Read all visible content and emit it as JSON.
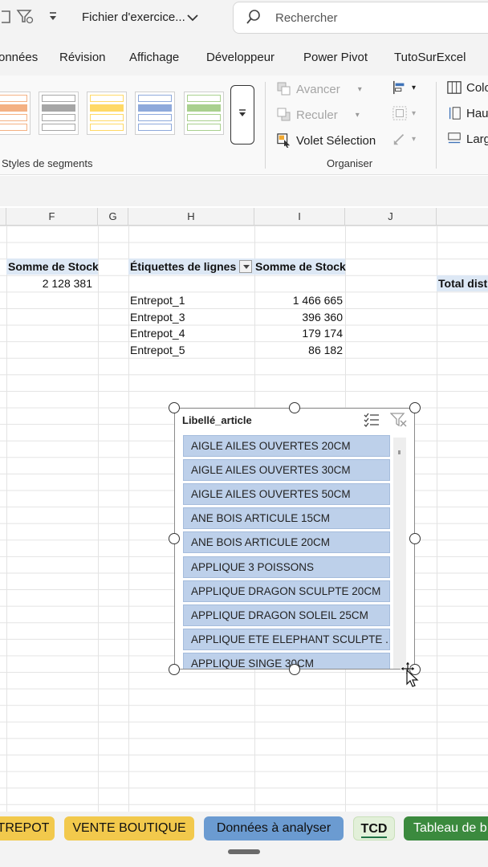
{
  "titlebar": {
    "file_name": "Fichier d'exercice...",
    "search_placeholder": "Rechercher"
  },
  "menu": [
    "onnées",
    "Révision",
    "Affichage",
    "Développeur",
    "Power Pivot",
    "TutoSurExcel"
  ],
  "ribbon": {
    "slicer_styles_label": "Styles de segments",
    "arrange_label": "Organiser",
    "bring_forward": "Avancer",
    "send_backward": "Reculer",
    "selection_pane": "Volet Sélection",
    "columns": "Colo",
    "height": "Hau",
    "width": "Larg",
    "style_colors": [
      "#f4b183",
      "#a6a6a6",
      "#ffd966",
      "#8ea9db",
      "#a9d08e"
    ]
  },
  "columns": [
    "F",
    "G",
    "H",
    "I",
    "J"
  ],
  "left_value_header": "Somme de Stock",
  "left_total": "2 128 381",
  "pivot": {
    "row_label_header": "Étiquettes de lignes",
    "value_header": "Somme de Stock",
    "rows": [
      {
        "label": "Entrepot_1",
        "value": "1 466 665"
      },
      {
        "label": "Entrepot_3",
        "value": "396 360"
      },
      {
        "label": "Entrepot_4",
        "value": "179 174"
      },
      {
        "label": "Entrepot_5",
        "value": "86 182"
      }
    ]
  },
  "right_header": "Total disti",
  "slicer": {
    "title": "Libellé_article",
    "items": [
      "AIGLE AILES OUVERTES 20CM",
      "AIGLE AILES OUVERTES 30CM",
      "AIGLE AILES OUVERTES 50CM",
      "ANE BOIS ARTICULE 15CM",
      "ANE BOIS ARTICULE 20CM",
      "APPLIQUE 3 POISSONS",
      "APPLIQUE DRAGON SCULPTE 20CM",
      "APPLIQUE DRAGON SOLEIL 25CM",
      "APPLIQUE ETE ELEPHANT SCULPTE ...",
      "APPLIQUE SINGE 30CM"
    ]
  },
  "sheet_tabs": [
    {
      "label": "TREPOT",
      "color": "#f2c94c"
    },
    {
      "label": "VENTE BOUTIQUE",
      "color": "#f2c94c"
    },
    {
      "label": "Données à analyser",
      "color": "#6b9bd1"
    },
    {
      "label": "TCD",
      "color": "#e2f0d9"
    },
    {
      "label": "Tableau de b",
      "color": "#3b8a3e"
    }
  ]
}
